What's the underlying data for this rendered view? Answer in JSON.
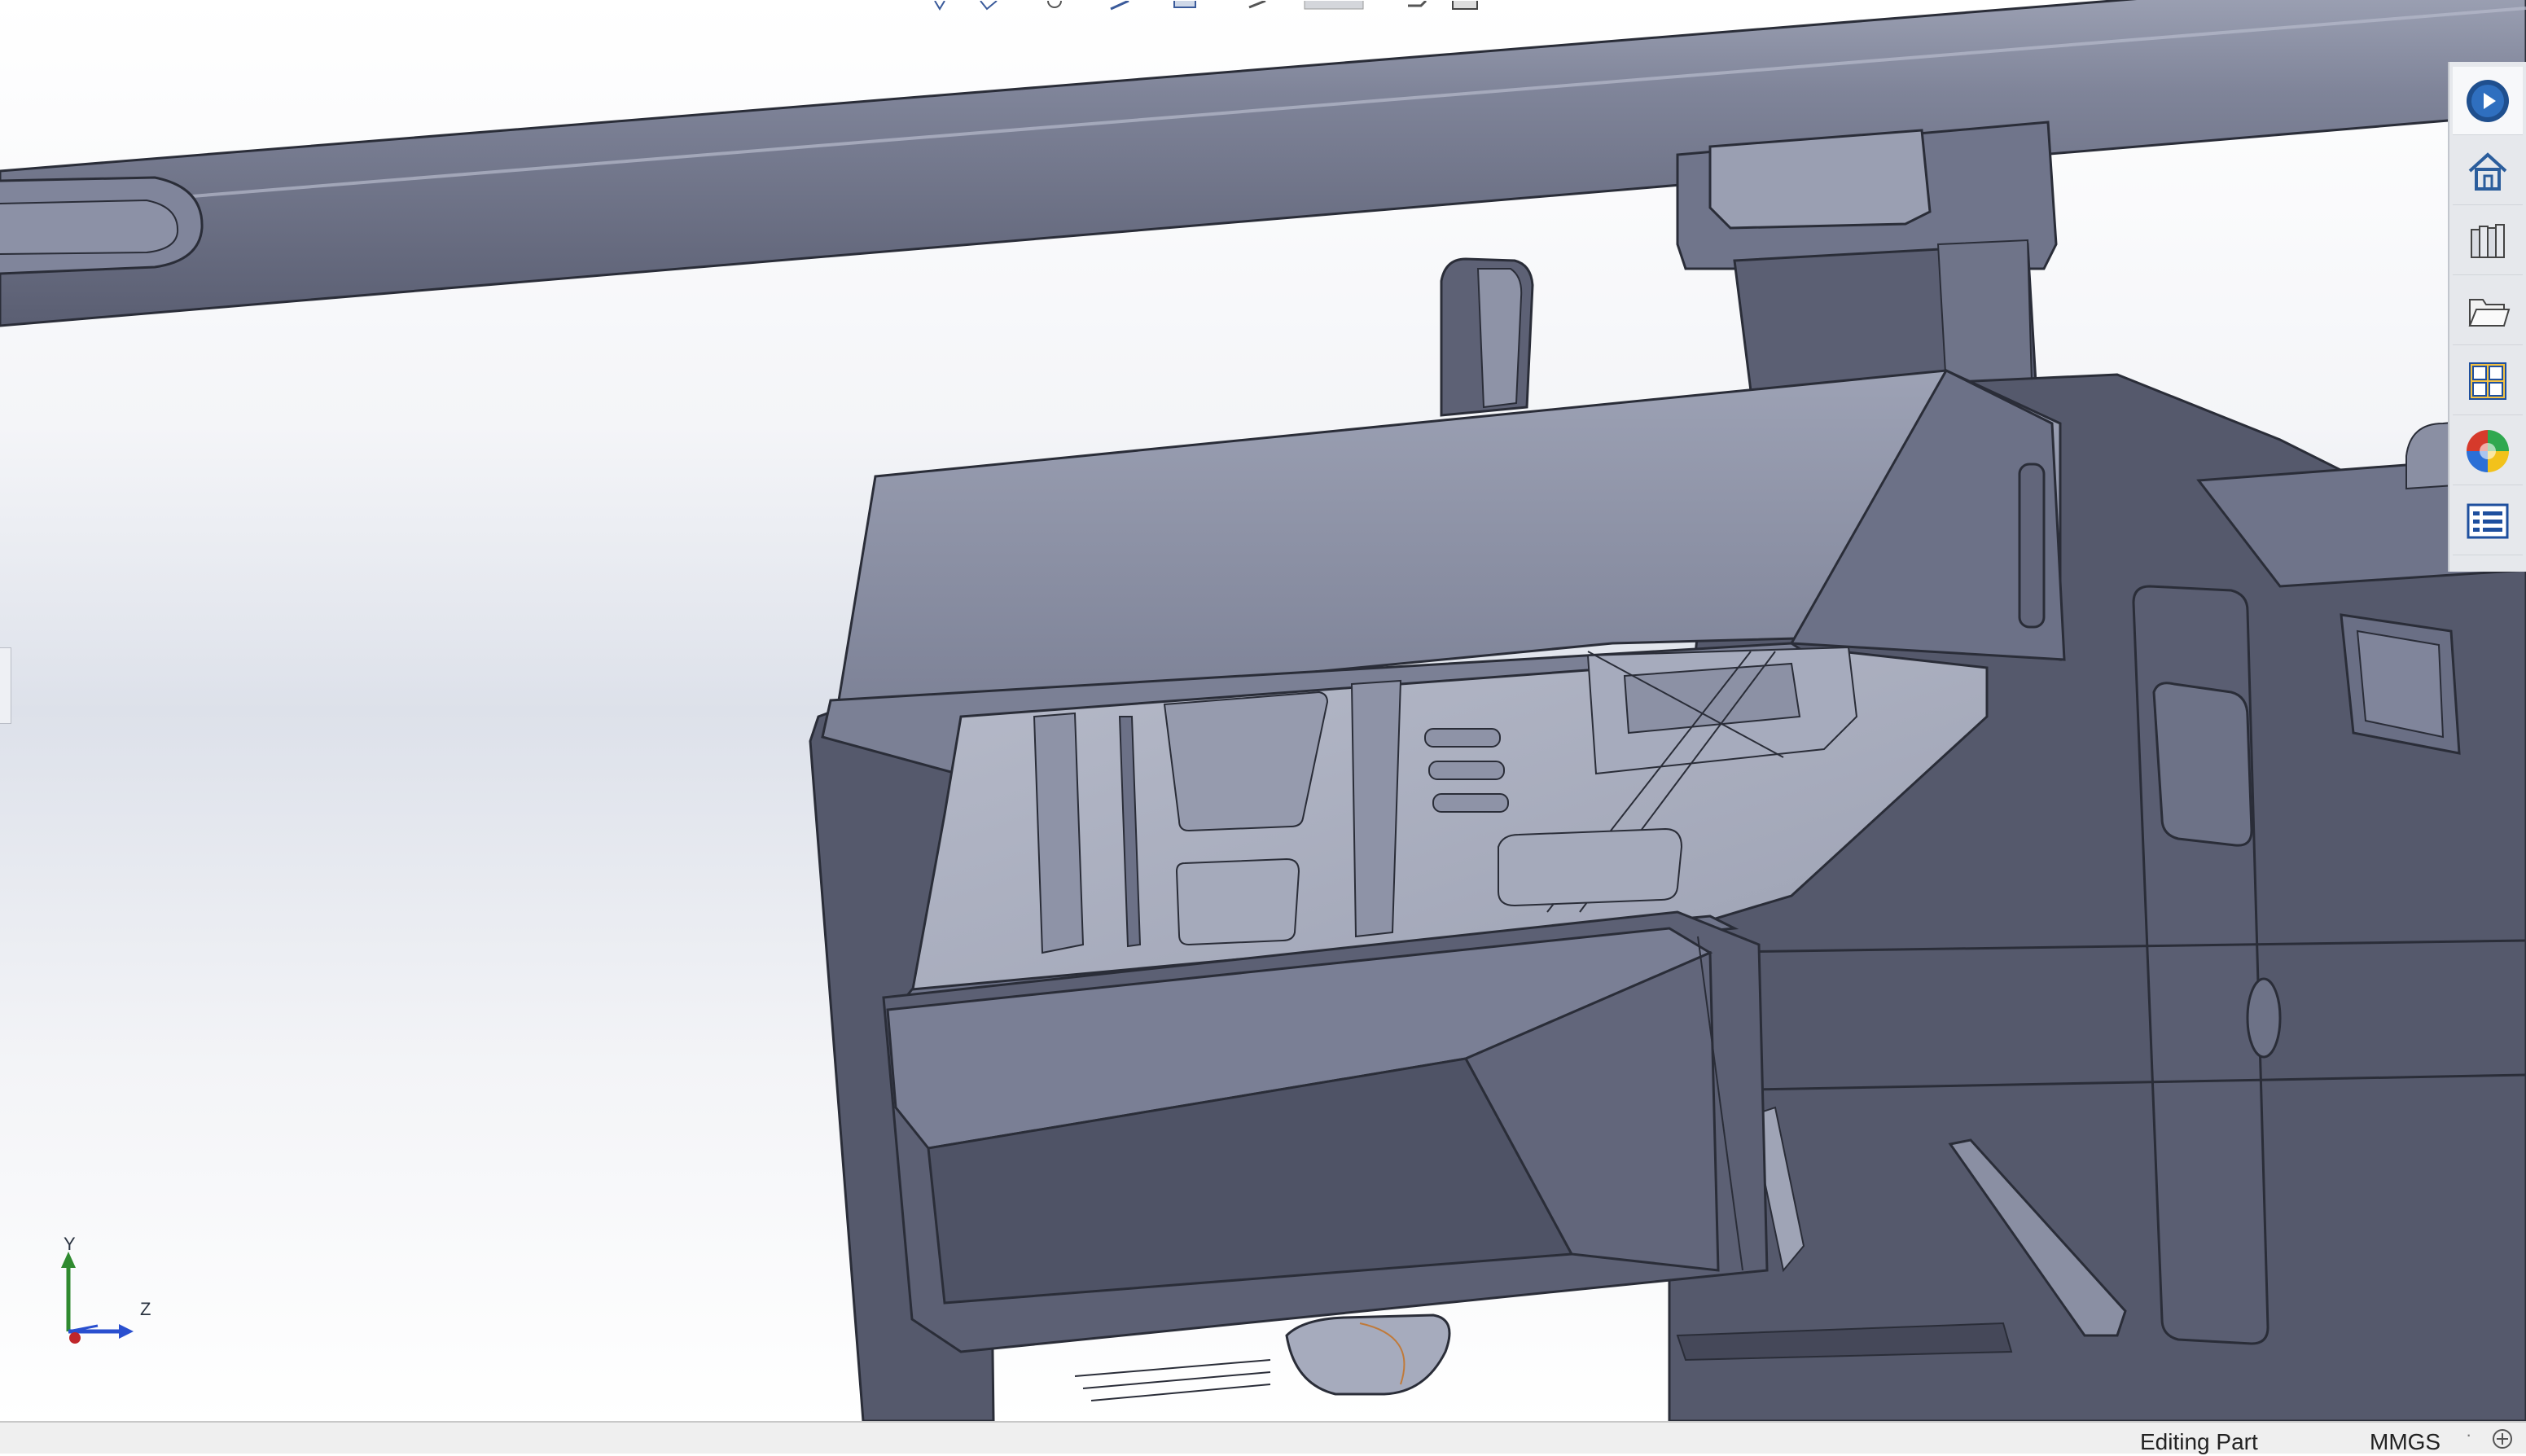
{
  "viewport": {
    "model_description_name": "3d-part-model",
    "triad": {
      "y_label": "Y",
      "z_label": "Z"
    }
  },
  "top_toolbar": {
    "icons": [
      "zoom-fit-icon",
      "zoom-area-icon",
      "previous-view-icon",
      "section-view-icon",
      "view-orientation-icon",
      "display-style-icon",
      "hide-show-icon",
      "appearance-icon",
      "scene-icon"
    ]
  },
  "task_pane": {
    "buttons": [
      {
        "name": "solidworks-resources",
        "icon": "solidworks-logo-icon"
      },
      {
        "name": "home",
        "icon": "home-icon"
      },
      {
        "name": "design-library",
        "icon": "design-library-icon"
      },
      {
        "name": "file-explorer",
        "icon": "folder-icon"
      },
      {
        "name": "view-palette",
        "icon": "view-palette-icon"
      },
      {
        "name": "appearances-scenes",
        "icon": "appearances-icon"
      },
      {
        "name": "custom-properties",
        "icon": "custom-properties-icon"
      }
    ]
  },
  "status_bar": {
    "mode": "Editing Part",
    "units": "MMGS",
    "separator": "·"
  },
  "colors": {
    "part_light": "#8d92a6",
    "part_mid": "#6b7086",
    "part_dark": "#4f5366",
    "edge": "#2a2d38"
  }
}
